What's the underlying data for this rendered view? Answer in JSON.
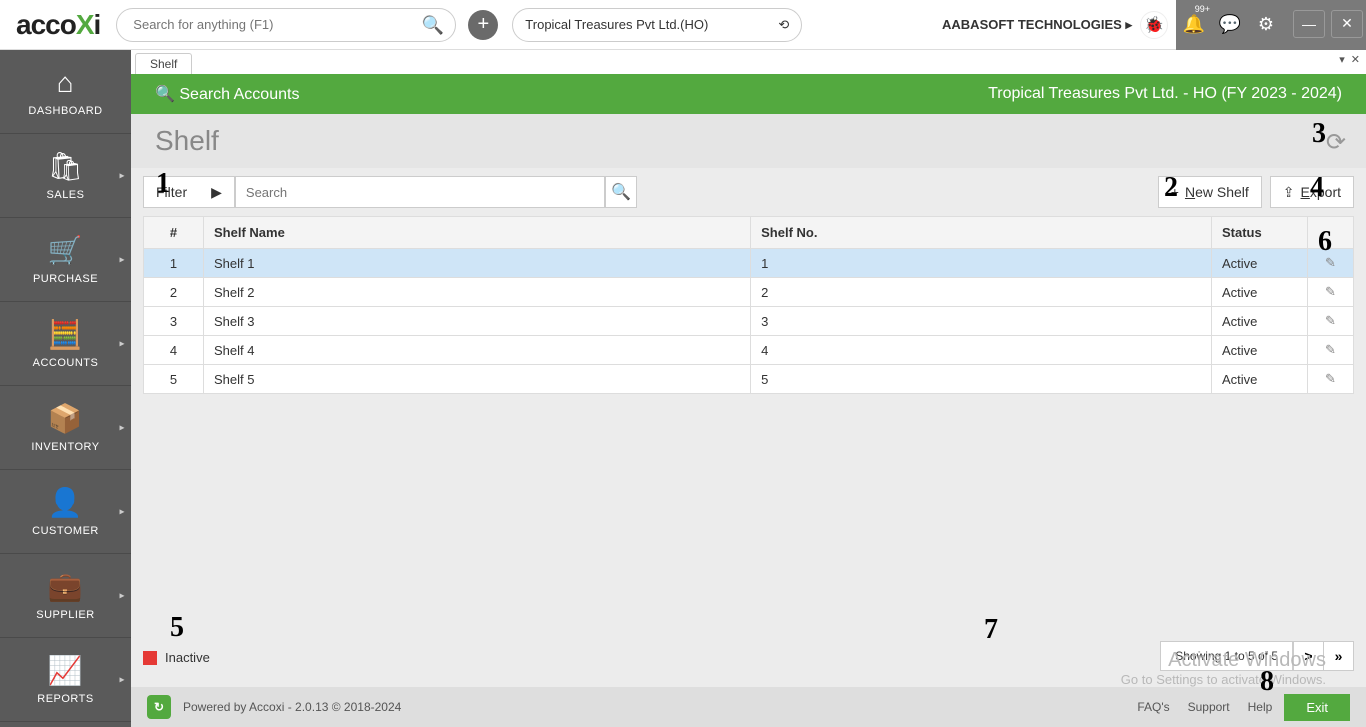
{
  "top": {
    "search_placeholder": "Search for anything (F1)",
    "company": "Tropical Treasures Pvt Ltd.(HO)",
    "org": "AABASOFT TECHNOLOGIES",
    "badge": "99+"
  },
  "sidebar": {
    "items": [
      {
        "label": "DASHBOARD",
        "icon": "⌂",
        "submenu": false
      },
      {
        "label": "SALES",
        "icon": "🛍",
        "submenu": true
      },
      {
        "label": "PURCHASE",
        "icon": "🛒",
        "submenu": true
      },
      {
        "label": "ACCOUNTS",
        "icon": "🧮",
        "submenu": true
      },
      {
        "label": "INVENTORY",
        "icon": "📦",
        "submenu": true
      },
      {
        "label": "CUSTOMER",
        "icon": "👤",
        "submenu": true
      },
      {
        "label": "SUPPLIER",
        "icon": "💼",
        "submenu": true
      },
      {
        "label": "REPORTS",
        "icon": "📈",
        "submenu": true
      }
    ]
  },
  "tab": {
    "label": "Shelf"
  },
  "greenbar": {
    "search": "Search Accounts",
    "context": "Tropical Treasures Pvt Ltd. - HO (FY 2023 - 2024)"
  },
  "page": {
    "title": "Shelf"
  },
  "toolbar": {
    "filter": "Filter",
    "search_placeholder": "Search",
    "new_shelf": "ew Shelf",
    "new_prefix": "N",
    "export": "xport",
    "export_prefix": "E"
  },
  "table": {
    "headers": {
      "num": "#",
      "name": "Shelf Name",
      "no": "Shelf No.",
      "status": "Status"
    },
    "rows": [
      {
        "num": "1",
        "name": "Shelf 1",
        "no": "1",
        "status": "Active",
        "selected": true
      },
      {
        "num": "2",
        "name": "Shelf 2",
        "no": "2",
        "status": "Active",
        "selected": false
      },
      {
        "num": "3",
        "name": "Shelf 3",
        "no": "3",
        "status": "Active",
        "selected": false
      },
      {
        "num": "4",
        "name": "Shelf 4",
        "no": "4",
        "status": "Active",
        "selected": false
      },
      {
        "num": "5",
        "name": "Shelf 5",
        "no": "5",
        "status": "Active",
        "selected": false
      }
    ]
  },
  "legend": {
    "inactive": "Inactive"
  },
  "pager": {
    "info": "Showing 1 to 5 of 5"
  },
  "footer": {
    "powered": "Powered by Accoxi - 2.0.13 © 2018-2024",
    "faq": "FAQ's",
    "support": "Support",
    "help": "Help",
    "exit": "Exit"
  },
  "watermark": {
    "line1": "Activate Windows",
    "line2": "Go to Settings to activate Windows."
  },
  "annotations": {
    "1": "1",
    "2": "2",
    "3": "3",
    "4": "4",
    "5": "5",
    "6": "6",
    "7": "7",
    "8": "8"
  }
}
